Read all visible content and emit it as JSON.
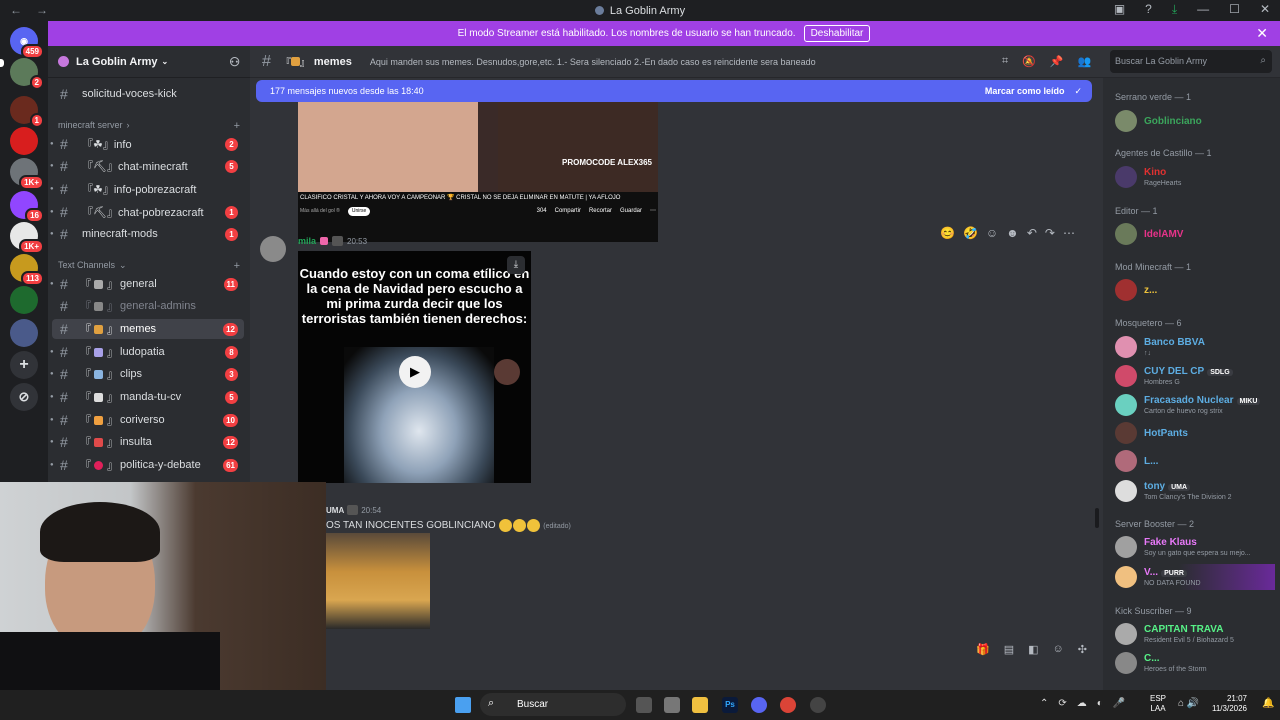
{
  "window": {
    "title": "La Goblin Army"
  },
  "guilds": [
    {
      "badge": "459"
    },
    {
      "badge": "2"
    },
    {
      "badge": "1"
    },
    {
      "badge": ""
    },
    {
      "badge": "1K+"
    },
    {
      "badge": "16"
    },
    {
      "badge": "1K+"
    },
    {
      "badge": "113"
    },
    {
      "badge": ""
    },
    {
      "badge": ""
    }
  ],
  "banner": {
    "text": "El modo Streamer está habilitado. Los nombres de usuario se han truncado.",
    "button": "Deshabilitar"
  },
  "server": {
    "name": "La Goblin Army"
  },
  "channels": {
    "top": {
      "label": "solicitud-voces-kick"
    },
    "cat1": "minecraft server",
    "mc": [
      {
        "label": "『☘』info",
        "badge": "2"
      },
      {
        "label": "『⛏』chat-minecraft",
        "badge": "5"
      },
      {
        "label": "『☘』info-pobrezacraft",
        "badge": ""
      },
      {
        "label": "『⛏』chat-pobrezacraft",
        "badge": "1"
      },
      {
        "label": "minecraft-mods",
        "badge": "1"
      }
    ],
    "cat2": "Text Channels",
    "text": [
      {
        "label": "general",
        "badge": "11"
      },
      {
        "label": "general-admins",
        "badge": ""
      },
      {
        "label": "memes",
        "badge": "12"
      },
      {
        "label": "ludopatia",
        "badge": "8"
      },
      {
        "label": "clips",
        "badge": "3"
      },
      {
        "label": "manda-tu-cv",
        "badge": "5"
      },
      {
        "label": "coriverso",
        "badge": "10"
      },
      {
        "label": "insulta",
        "badge": "12"
      },
      {
        "label": "politica-y-debate",
        "badge": "61"
      }
    ]
  },
  "header": {
    "channel": "memes",
    "topic": "Aqui manden sus memes. Desnudos,gore,etc. 1.- Sera silenciado 2.-En dado caso es reincidente sera baneado",
    "search_placeholder": "Buscar La Goblin Army"
  },
  "newbar": {
    "text": "177 mensajes nuevos desde las 18:40",
    "mark": "Marcar como leído"
  },
  "thumb": {
    "caption": "CLASIFICO CRISTAL Y AHORA VOY A CAMPEONAR 🏆 CRISTAL NO SE DEJA ELIMINAR EN MATUTE | YA AFLOJO",
    "channel": "Más allá del gol ®",
    "join": "Unirse",
    "likes": "304",
    "share": "Compartir",
    "clip": "Recortar",
    "save": "Guardar",
    "promo": "PROMOCODE ALEX365"
  },
  "msg2": {
    "author": "mila",
    "time": "20:53"
  },
  "video": {
    "text": "Cuando estoy con un coma etílico en la cena de Navidad pero escucho a mi prima zurda decir que los terroristas también tienen derechos:"
  },
  "msg3": {
    "author": "UMA",
    "time": "20:54",
    "text": "OS TAN INOCENTES GOBLINCIANO",
    "edited": "(editado)"
  },
  "members": {
    "roles": [
      "Serrano verde — 1",
      "Agentes de Castillo — 1",
      "Editor — 1",
      "Mod Minecraft — 1",
      "Mosquetero — 6",
      "Server Booster — 2",
      "Kick Suscriber — 9"
    ],
    "list": [
      {
        "name": "Goblinciano",
        "sub": "",
        "color": "#3ba55c"
      },
      {
        "name": "Kino",
        "sub": "RageHearts",
        "color": "#e03131"
      },
      {
        "name": "IdelAMV",
        "sub": "",
        "color": "#e8338a"
      },
      {
        "name": "z...",
        "sub": "",
        "color": "#f0c43c"
      },
      {
        "name": "Banco BBVA",
        "sub": "↑↓",
        "color": "#5dade2"
      },
      {
        "name": "CUY DEL CP",
        "sub": "Hombres G",
        "color": "#5dade2",
        "tag": "SDLG"
      },
      {
        "name": "Fracasado Nuclear",
        "sub": "Carton de huevo rog strix",
        "color": "#5dade2",
        "tag": "MIKU"
      },
      {
        "name": "HotPants",
        "sub": "",
        "color": "#5dade2"
      },
      {
        "name": "L...",
        "sub": "",
        "color": "#5dade2"
      },
      {
        "name": "tony",
        "sub": "Tom Clancy's The Division 2",
        "color": "#5dade2",
        "tag": "UMA"
      },
      {
        "name": "Fake Klaus",
        "sub": "Soy un gato que espera su mejo...",
        "color": "#e879f9"
      },
      {
        "name": "V...",
        "sub": "NO DATA FOUND",
        "color": "#e879f9",
        "tag": "PURR"
      },
      {
        "name": "CAPITAN TRAVA",
        "sub": "Resident Evil 5 / Biohazard 5",
        "color": "#57f287"
      },
      {
        "name": "C...",
        "sub": "Heroes of the Storm",
        "color": "#57f287"
      }
    ]
  },
  "taskbar": {
    "search": "Buscar",
    "lang1": "ESP",
    "lang2": "LAA",
    "time": "21:07",
    "date": "11/3/2026"
  }
}
